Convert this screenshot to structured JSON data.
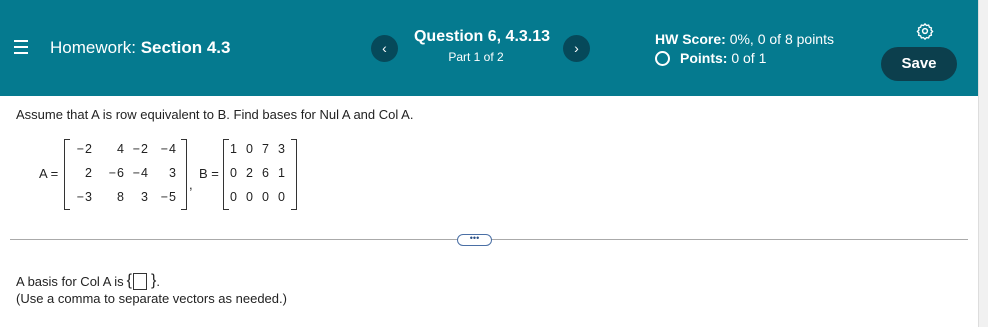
{
  "header": {
    "menu_icon": "hamburger-menu-icon",
    "homework_label": "Homework:",
    "section_label": "Section 4.3",
    "prev_label": "‹",
    "next_label": "›",
    "question_title": "Question 6, 4.3.13",
    "part_label": "Part 1 of 2",
    "hw_score_label": "HW Score:",
    "hw_score_value": "0%, 0 of 8 points",
    "points_label": "Points:",
    "points_value": "0 of 1",
    "save_label": "Save",
    "settings_icon": "gear-icon"
  },
  "problem": {
    "prompt": "Assume that A is row equivalent to B. Find bases for Nul A and Col A.",
    "matrix_a_label": "A =",
    "matrix_a": [
      [
        "−2",
        "4",
        "−2",
        "−4"
      ],
      [
        "2",
        "−6",
        "−4",
        "3"
      ],
      [
        "−3",
        "8",
        "3",
        "−5"
      ]
    ],
    "separator": ",",
    "matrix_b_label": "B =",
    "matrix_b": [
      [
        "1",
        "0",
        "7",
        "3"
      ],
      [
        "0",
        "2",
        "6",
        "1"
      ],
      [
        "0",
        "0",
        "0",
        "0"
      ]
    ]
  },
  "more_label": "•••",
  "answer": {
    "prefix": "A basis for Col A is",
    "open_brace": "{",
    "close_brace": "}",
    "suffix": ".",
    "note": "(Use a comma to separate vectors as needed.)"
  },
  "colors": {
    "header_bg": "#057a8f",
    "save_bg": "#0c3f4d",
    "nav_bg": "#06495a"
  }
}
